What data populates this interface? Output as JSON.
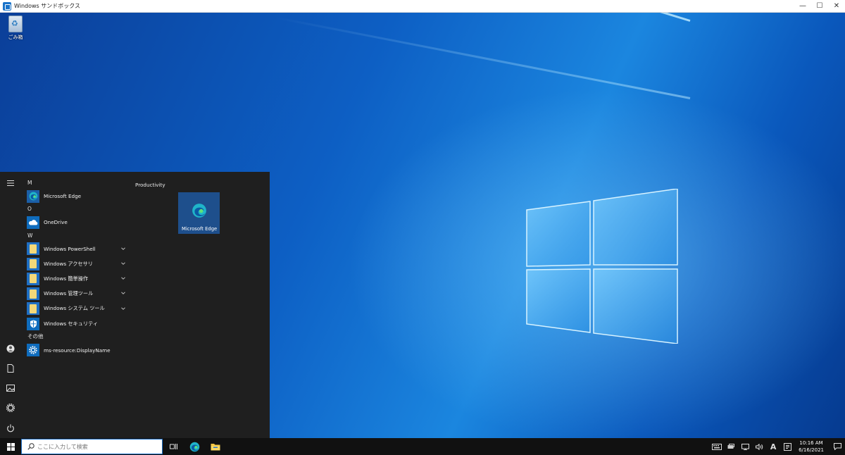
{
  "window": {
    "title": "Windows サンドボックス",
    "controls": {
      "minimize": "—",
      "maximize": "☐",
      "close": "✕"
    }
  },
  "desktop": {
    "icons": [
      {
        "label": "ごみ箱",
        "icon": "recycle-bin-icon"
      }
    ]
  },
  "start_menu": {
    "rail": [
      "hamburger-icon",
      "user-icon",
      "documents-icon",
      "pictures-icon",
      "settings-icon",
      "power-icon"
    ],
    "sections": [
      {
        "letter": "M",
        "apps": [
          {
            "name": "Microsoft Edge",
            "icon": "edge-icon"
          }
        ]
      },
      {
        "letter": "O",
        "apps": [
          {
            "name": "OneDrive",
            "icon": "onedrive-icon"
          }
        ]
      },
      {
        "letter": "W",
        "apps": [
          {
            "name": "Windows PowerShell",
            "icon": "folder-icon",
            "expandable": true
          },
          {
            "name": "Windows アクセサリ",
            "icon": "folder-icon",
            "expandable": true
          },
          {
            "name": "Windows 簡単操作",
            "icon": "folder-icon",
            "expandable": true
          },
          {
            "name": "Windows 管理ツール",
            "icon": "folder-icon",
            "expandable": true
          },
          {
            "name": "Windows システム ツール",
            "icon": "folder-icon",
            "expandable": true
          },
          {
            "name": "Windows セキュリティ",
            "icon": "shield-icon",
            "expandable": false
          }
        ]
      },
      {
        "letter": "その他",
        "apps": [
          {
            "name": "ms-resource:DisplayName",
            "icon": "gear-icon"
          }
        ]
      }
    ],
    "group_title": "Productivity",
    "tiles": [
      {
        "label": "Microsoft Edge",
        "icon": "edge-icon"
      }
    ]
  },
  "taskbar": {
    "search_placeholder": "ここに入力して検索",
    "pinned": [
      "task-view-icon",
      "edge-icon",
      "file-explorer-icon"
    ],
    "tray": {
      "ime": "A",
      "time": "10:16 AM",
      "date": "6/16/2021"
    }
  },
  "colors": {
    "accent": "#1f6fc4",
    "taskbar": "#111111",
    "start_bg": "#1f1f1f"
  }
}
